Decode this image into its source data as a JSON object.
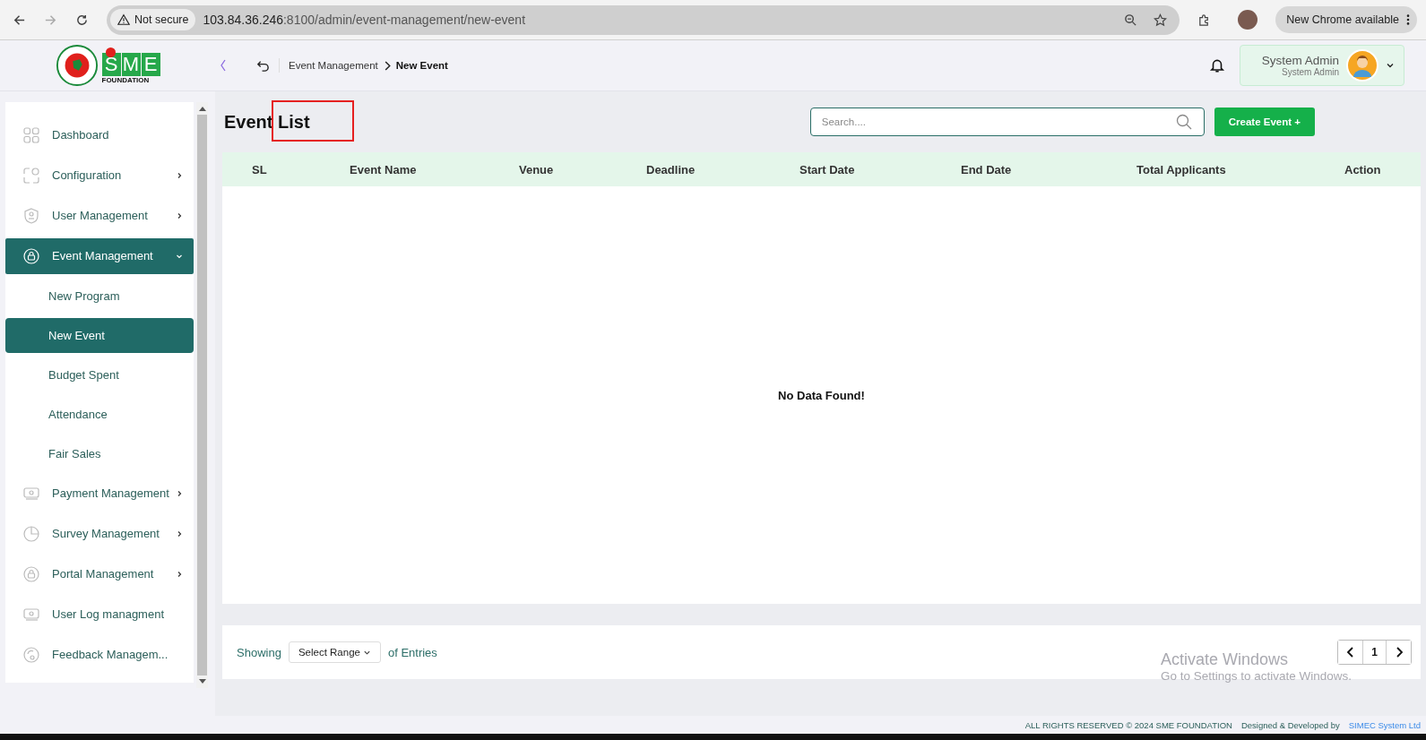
{
  "browser": {
    "security_label": "Not secure",
    "url_host": "103.84.36.246",
    "url_rest": ":8100/admin/event-management/new-event",
    "update_label": "New Chrome available"
  },
  "logo": {
    "letters": [
      "S",
      "M",
      "E"
    ],
    "subtitle": "FOUNDATION"
  },
  "breadcrumb": [
    "Event Management",
    "New Event"
  ],
  "user": {
    "name": "System Admin",
    "role": "System Admin"
  },
  "sidebar": {
    "items": [
      {
        "label": "Dashboard",
        "expandable": false,
        "selected": false
      },
      {
        "label": "Configuration",
        "expandable": true,
        "expanded": false,
        "selected": false
      },
      {
        "label": "User Management",
        "expandable": true,
        "expanded": false,
        "selected": false
      },
      {
        "label": "Event Management",
        "expandable": true,
        "expanded": true,
        "selected": true,
        "children": [
          {
            "label": "New Program",
            "selected": false
          },
          {
            "label": "New Event",
            "selected": true
          },
          {
            "label": "Budget Spent",
            "selected": false
          },
          {
            "label": "Attendance",
            "selected": false
          },
          {
            "label": "Fair Sales",
            "selected": false
          }
        ]
      },
      {
        "label": "Payment Management",
        "expandable": true,
        "expanded": false,
        "selected": false
      },
      {
        "label": "Survey Management",
        "expandable": true,
        "expanded": false,
        "selected": false
      },
      {
        "label": "Portal Management",
        "expandable": true,
        "expanded": false,
        "selected": false
      },
      {
        "label": "User Log managment",
        "expandable": false,
        "selected": false
      },
      {
        "label": "Feedback Managem...",
        "expandable": false,
        "selected": false
      }
    ]
  },
  "page": {
    "title_words": [
      "Event",
      "List"
    ],
    "search": {
      "placeholder": "Search...."
    },
    "create_button": "Create Event +"
  },
  "table": {
    "columns": [
      "SL",
      "Event Name",
      "Venue",
      "Deadline",
      "Start Date",
      "End Date",
      "Total Applicants",
      "Action"
    ],
    "empty_message": "No Data Found!"
  },
  "pagination": {
    "showing": "Showing",
    "range": "Select Range",
    "of_entries": "of Entries",
    "pages": [
      {
        "label": "1",
        "selected": true
      }
    ]
  },
  "os_notice": {
    "title": "Activate Windows",
    "subtitle": "Go to Settings to activate Windows."
  },
  "footer": {
    "rights": "ALL RIGHTS RESERVED © 2024 SME FOUNDATION",
    "designed": "Designed & Developed by",
    "company": "SIMEC System Ltd"
  }
}
